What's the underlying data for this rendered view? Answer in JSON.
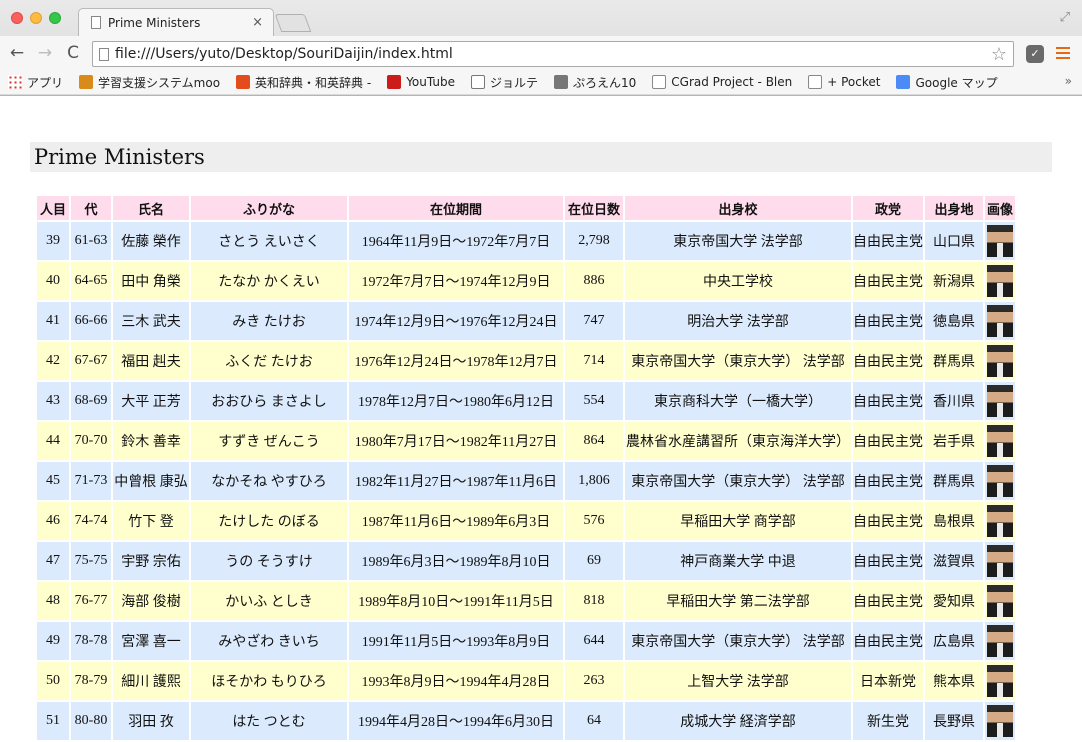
{
  "browser": {
    "tab_title": "Prime Ministers",
    "tab_close": "×",
    "url": "file:///Users/yuto/Desktop/SouriDaijin/index.html",
    "back": "←",
    "forward": "→",
    "reload": "C",
    "star": "☆",
    "bookmarks": [
      {
        "label": "アプリ",
        "icon": "apps-icon"
      },
      {
        "label": "学習支援システムmoo",
        "icon": "moodle-icon"
      },
      {
        "label": "英和辞典・和英辞典 -",
        "icon": "weblio-icon"
      },
      {
        "label": "YouTube",
        "icon": "youtube-icon"
      },
      {
        "label": "ジョルテ",
        "icon": "jorte-icon"
      },
      {
        "label": "ぷろえん10",
        "icon": "proen-icon"
      },
      {
        "label": "CGrad Project - Blen",
        "icon": "document-icon"
      },
      {
        "label": "+ Pocket",
        "icon": "document-icon"
      },
      {
        "label": "Google マップ",
        "icon": "google-maps-icon"
      }
    ],
    "bookmarks_more": "»"
  },
  "page": {
    "heading": "Prime Ministers",
    "columns": [
      "人目",
      "代",
      "氏名",
      "ふりがな",
      "在位期間",
      "在位日数",
      "出身校",
      "政党",
      "出身地",
      "画像"
    ],
    "rows": [
      [
        "39",
        "61-63",
        "佐藤 榮作",
        "さとう えいさく",
        "1964年11月9日〜1972年7月7日",
        "2,798",
        "東京帝国大学 法学部",
        "自由民主党",
        "山口県"
      ],
      [
        "40",
        "64-65",
        "田中 角榮",
        "たなか かくえい",
        "1972年7月7日〜1974年12月9日",
        "886",
        "中央工学校",
        "自由民主党",
        "新潟県"
      ],
      [
        "41",
        "66-66",
        "三木 武夫",
        "みき たけお",
        "1974年12月9日〜1976年12月24日",
        "747",
        "明治大学 法学部",
        "自由民主党",
        "徳島県"
      ],
      [
        "42",
        "67-67",
        "福田 赳夫",
        "ふくだ たけお",
        "1976年12月24日〜1978年12月7日",
        "714",
        "東京帝国大学（東京大学） 法学部",
        "自由民主党",
        "群馬県"
      ],
      [
        "43",
        "68-69",
        "大平 正芳",
        "おおひら まさよし",
        "1978年12月7日〜1980年6月12日",
        "554",
        "東京商科大学（一橋大学）",
        "自由民主党",
        "香川県"
      ],
      [
        "44",
        "70-70",
        "鈴木 善幸",
        "すずき ぜんこう",
        "1980年7月17日〜1982年11月27日",
        "864",
        "農林省水産講習所（東京海洋大学）",
        "自由民主党",
        "岩手県"
      ],
      [
        "45",
        "71-73",
        "中曾根 康弘",
        "なかそね やすひろ",
        "1982年11月27日〜1987年11月6日",
        "1,806",
        "東京帝国大学（東京大学） 法学部",
        "自由民主党",
        "群馬県"
      ],
      [
        "46",
        "74-74",
        "竹下 登",
        "たけした のぼる",
        "1987年11月6日〜1989年6月3日",
        "576",
        "早稲田大学 商学部",
        "自由民主党",
        "島根県"
      ],
      [
        "47",
        "75-75",
        "宇野 宗佑",
        "うの そうすけ",
        "1989年6月3日〜1989年8月10日",
        "69",
        "神戸商業大学 中退",
        "自由民主党",
        "滋賀県"
      ],
      [
        "48",
        "76-77",
        "海部 俊樹",
        "かいふ としき",
        "1989年8月10日〜1991年11月5日",
        "818",
        "早稲田大学 第二法学部",
        "自由民主党",
        "愛知県"
      ],
      [
        "49",
        "78-78",
        "宮澤 喜一",
        "みやざわ きいち",
        "1991年11月5日〜1993年8月9日",
        "644",
        "東京帝国大学（東京大学） 法学部",
        "自由民主党",
        "広島県"
      ],
      [
        "50",
        "78-79",
        "細川 護熙",
        "ほそかわ もりひろ",
        "1993年8月9日〜1994年4月28日",
        "263",
        "上智大学 法学部",
        "日本新党",
        "熊本県"
      ],
      [
        "51",
        "80-80",
        "羽田 孜",
        "はた つとむ",
        "1994年4月28日〜1994年6月30日",
        "64",
        "成城大学 経済学部",
        "新生党",
        "長野県"
      ]
    ]
  }
}
